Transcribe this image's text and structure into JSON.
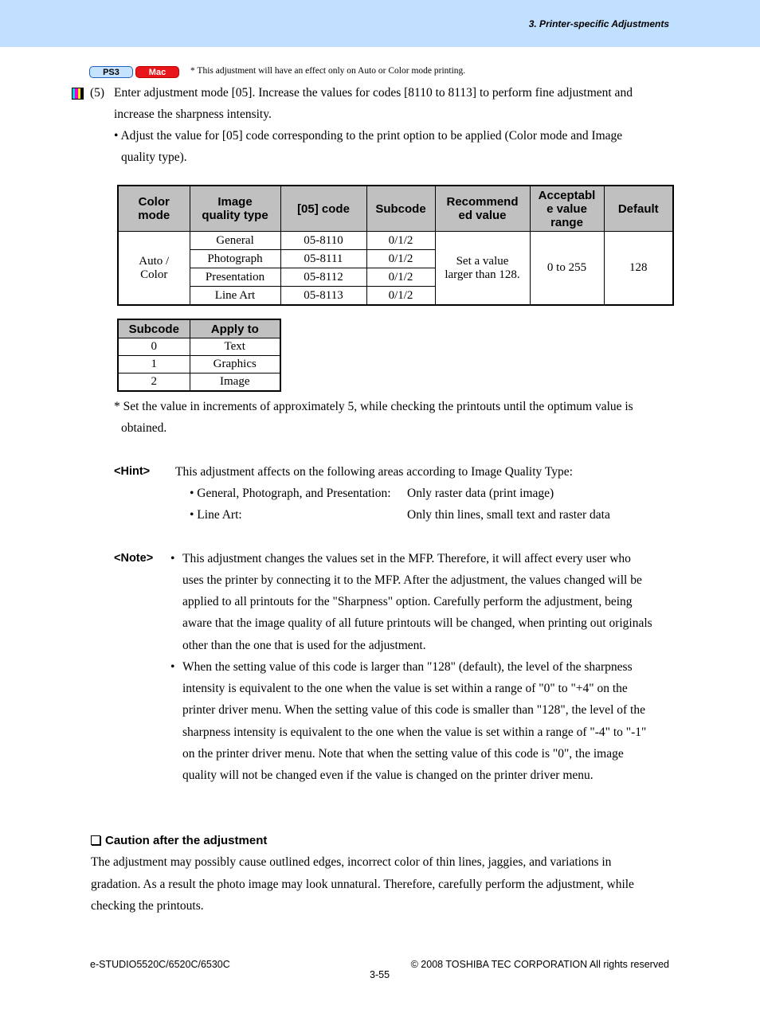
{
  "header": {
    "title": "3. Printer-specific Adjustments",
    "bg_color": "#c1dfff"
  },
  "badges": {
    "ps3": "PS3",
    "mac": "Mac",
    "note": "* This adjustment will have an effect only on Auto or Color mode printing."
  },
  "step": {
    "number": "(5)",
    "line1": "Enter adjustment mode [05].  Increase the values for codes [8110 to 8113] to perform fine adjustment and",
    "line2": "increase the sharpness intensity.",
    "bullet_line1": "• Adjust the value for [05] code corresponding to the print option to be applied (Color mode and Image",
    "bullet_line2": "quality type)."
  },
  "main_table": {
    "headers": [
      "Color mode",
      "Image quality type",
      "[05] code",
      "Subcode",
      "Recommended value",
      "Acceptable value range",
      "Default"
    ],
    "header_lines": [
      [
        "Color",
        "mode"
      ],
      [
        "Image",
        "quality type"
      ],
      [
        "[05] code"
      ],
      [
        "Subcode"
      ],
      [
        "Recommend",
        "ed value"
      ],
      [
        "Acceptabl",
        "e value",
        "range"
      ],
      [
        "Default"
      ]
    ],
    "color_mode": "Auto / Color",
    "color_mode_lines": [
      "Auto /",
      "Color"
    ],
    "rows": [
      {
        "type": "General",
        "code": "05-8110",
        "subcode": "0/1/2"
      },
      {
        "type": "Photograph",
        "code": "05-8111",
        "subcode": "0/1/2"
      },
      {
        "type": "Presentation",
        "code": "05-8112",
        "subcode": "0/1/2"
      },
      {
        "type": "Line Art",
        "code": "05-8113",
        "subcode": "0/1/2"
      }
    ],
    "recommended_lines": [
      "Set a value",
      "larger than 128."
    ],
    "range": "0 to 255",
    "default": "128"
  },
  "sub_table": {
    "headers": [
      "Subcode",
      "Apply to"
    ],
    "rows": [
      {
        "subcode": "0",
        "apply": "Text"
      },
      {
        "subcode": "1",
        "apply": "Graphics"
      },
      {
        "subcode": "2",
        "apply": "Image"
      }
    ]
  },
  "increment_note": {
    "line1": "* Set the value in increments of approximately 5, while checking the printouts until the optimum value is",
    "line2": "obtained."
  },
  "hint": {
    "label": "<Hint>",
    "intro": "This adjustment affects on the following areas according to Image Quality Type:",
    "items": [
      {
        "type": "• General, Photograph, and Presentation:",
        "effect": "Only raster data (print image)"
      },
      {
        "type": "• Line Art:",
        "effect": "Only thin lines, small text and raster data"
      }
    ]
  },
  "note": {
    "label": "<Note>",
    "bullet1": [
      "This adjustment changes the values set in the MFP.  Therefore, it will affect every user who",
      "uses the printer by connecting it to the MFP.  After the adjustment, the values changed will be",
      "applied to all printouts for the \"Sharpness\" option.  Carefully perform the adjustment, being",
      "aware that the image quality of all future printouts will be changed, when printing out originals",
      "other than the one that is used for the adjustment."
    ],
    "bullet2": [
      "When the setting value of this code is larger than \"128\" (default), the level of the sharpness",
      "intensity is equivalent to the one when the value is set within a range of \"0\" to \"+4\" on the",
      "printer driver menu. When the setting value of this code is smaller than \"128\", the level of the",
      "sharpness intensity is equivalent to the one when the value is set within a range of \"-4\" to \"-1\"",
      "on the printer driver menu. Note that when the setting value of this code is \"0\", the image",
      "quality will not be changed even if the value is changed on the printer driver menu."
    ]
  },
  "caution": {
    "title": "Caution after the adjustment",
    "lines": [
      "The adjustment may possibly cause outlined edges, incorrect color of thin lines, jaggies, and variations in",
      "gradation.  As a result the photo image may look unnatural.  Therefore, carefully perform the adjustment, while",
      "checking the printouts."
    ]
  },
  "footer": {
    "model": "e-STUDIO5520C/6520C/6530C",
    "copyright": "© 2008 TOSHIBA TEC CORPORATION All rights reserved",
    "page": "3-55"
  }
}
